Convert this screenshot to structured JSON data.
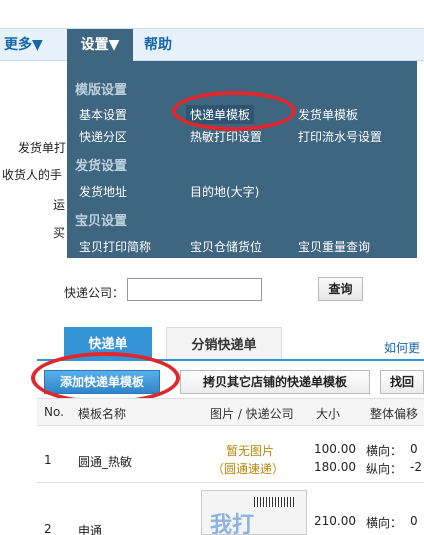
{
  "top": {
    "nav": {
      "more": "更多▼",
      "settings": "设置▼",
      "help": "帮助"
    },
    "under_texts": [
      "发货单打",
      "收货人的手",
      "运",
      "买"
    ],
    "dropdown": {
      "sections": [
        {
          "title": "模版设置",
          "items": [
            "基本设置",
            "快递单模板",
            "发货单模板",
            "快递分区",
            "热敏打印设置",
            "打印流水号设置"
          ]
        },
        {
          "title": "发货设置",
          "items": [
            "发货地址",
            "目的地(大字)"
          ]
        },
        {
          "title": "宝贝设置",
          "items": [
            "宝贝打印简称",
            "宝贝仓储货位",
            "宝贝重量查询"
          ]
        }
      ]
    }
  },
  "bottom": {
    "express_company_label": "快递公司：",
    "express_company_value": "",
    "query_button": "查询",
    "tabs": [
      "快递单",
      "分销快递单"
    ],
    "howto_link": "如何更",
    "buttons": {
      "add": "添加快递单模板",
      "copy": "拷贝其它店铺的快递单模板",
      "back": "找回"
    },
    "table": {
      "headers": [
        "No.",
        "模板名称",
        "图片 / 快递公司",
        "大小",
        "整体偏移"
      ],
      "rows": [
        {
          "no": "1",
          "name": "圆通_热敏",
          "image": "暂无图片",
          "company": "（圆通速递）",
          "width": "100.00",
          "height": "180.00",
          "offset_h_label": "横向：",
          "offset_h": "0",
          "offset_v_label": "纵向：",
          "offset_v": "-2"
        },
        {
          "no": "2",
          "name": "申通",
          "image_stamp": "我打",
          "width": "210.00",
          "offset_h_label": "横向：",
          "offset_h": "0"
        }
      ]
    }
  },
  "colors": {
    "menu_bg": "#3f6680",
    "tab_blue": "#3594d6",
    "highlight_red": "#e0272c"
  }
}
